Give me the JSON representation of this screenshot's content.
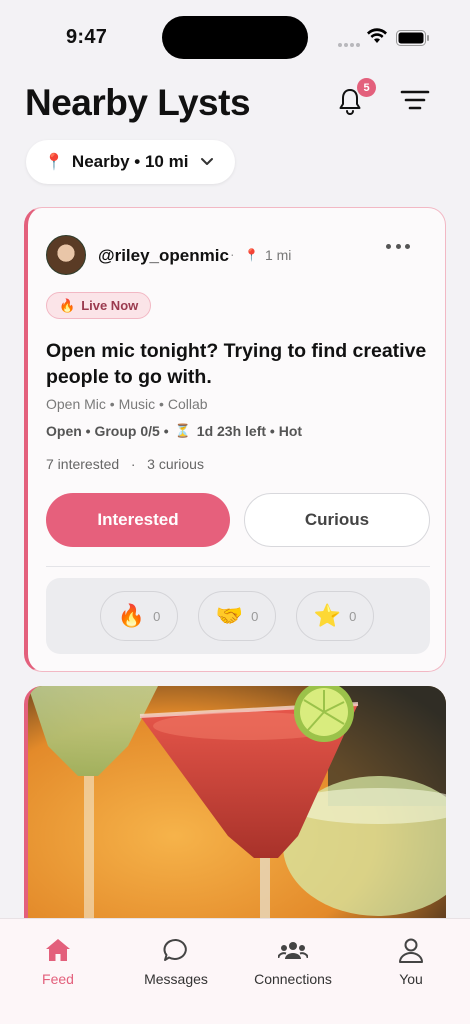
{
  "status_bar": {
    "time": "9:47"
  },
  "header": {
    "title": "Nearby Lysts",
    "notification_count": "5"
  },
  "location_filter": {
    "label": "Nearby • 10 mi"
  },
  "post": {
    "username": "@riley_openmic",
    "separator": "·",
    "distance": "1 mi",
    "live_badge": "Live Now",
    "title": "Open mic tonight? Trying to find creative people to go with.",
    "tags": "Open Mic • Music • Collab",
    "meta_left": "Open • Group 0/5 •",
    "meta_right": "1d 23h left • Hot",
    "counts": "7 interested   ·   3 curious",
    "interested_label": "Interested",
    "curious_label": "Curious",
    "reactions": [
      {
        "icon": "fire-icon",
        "emoji": "🔥",
        "count": "0"
      },
      {
        "icon": "handshake-icon",
        "emoji": "🤝",
        "count": "0"
      },
      {
        "icon": "star-icon",
        "emoji": "⭐",
        "count": "0"
      }
    ]
  },
  "tabs": [
    {
      "label": "Feed",
      "icon": "home-icon",
      "active": true
    },
    {
      "label": "Messages",
      "icon": "chat-icon",
      "active": false
    },
    {
      "label": "Connections",
      "icon": "people-icon",
      "active": false
    },
    {
      "label": "You",
      "icon": "person-icon",
      "active": false
    }
  ],
  "colors": {
    "accent": "#e3607c",
    "background": "#f3f2f5"
  }
}
